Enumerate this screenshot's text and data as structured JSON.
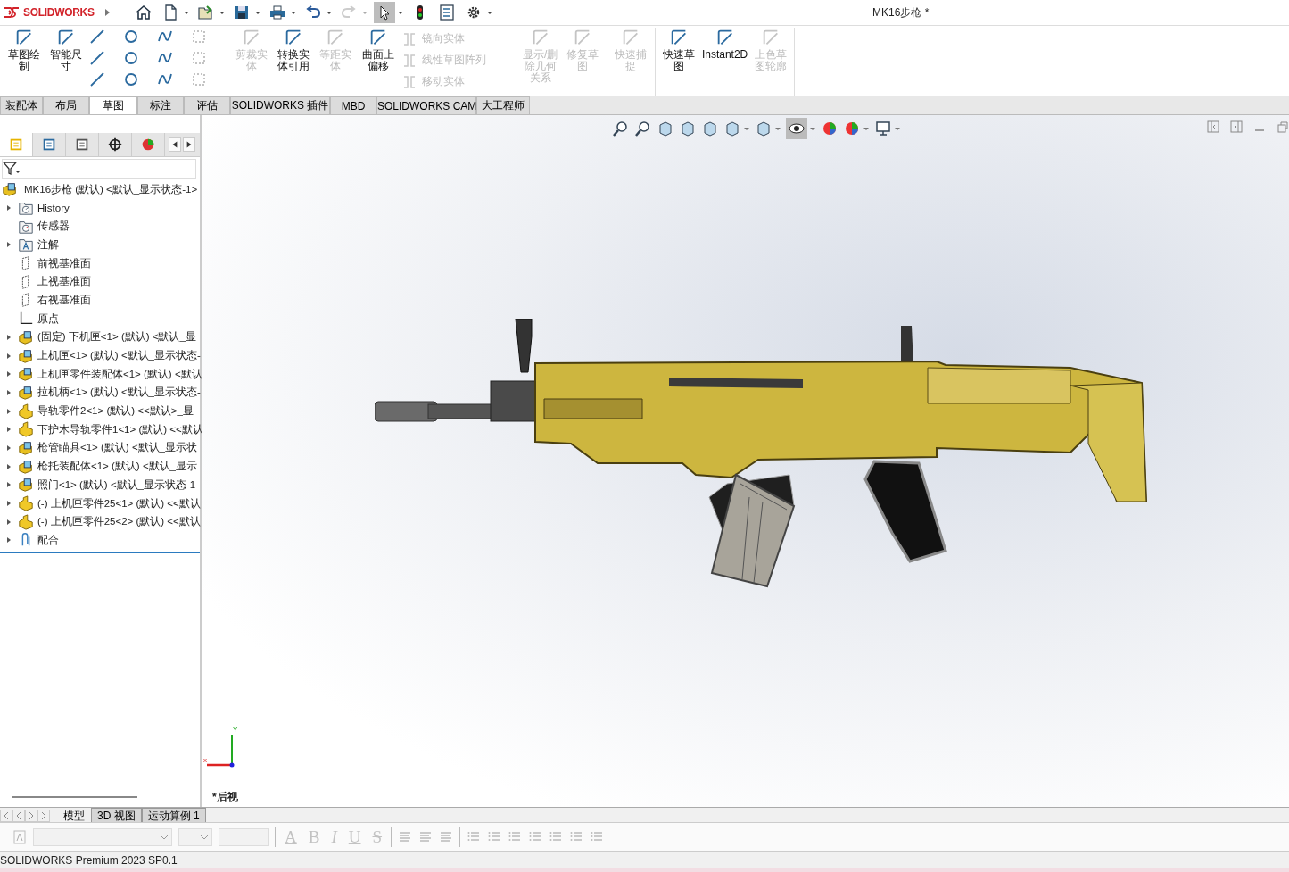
{
  "app": {
    "brand": "SOLIDWORKS",
    "title": "MK16步枪 *"
  },
  "command_groups": [
    {
      "buttons": [
        {
          "label": "草图绘制",
          "disabled": false
        },
        {
          "label": "智能尺寸",
          "disabled": false
        }
      ]
    },
    {
      "buttons": [
        {
          "label": "剪裁实体",
          "disabled": true
        },
        {
          "label": "转换实体引用",
          "disabled": false
        },
        {
          "label": "等距实体",
          "disabled": true
        },
        {
          "label": "曲面上偏移",
          "disabled": false
        }
      ],
      "list": [
        {
          "label": "镜向实体",
          "disabled": true
        },
        {
          "label": "线性草图阵列",
          "disabled": true
        },
        {
          "label": "移动实体",
          "disabled": true
        }
      ]
    },
    {
      "buttons": [
        {
          "label": "显示/删除几何关系",
          "disabled": true
        },
        {
          "label": "修复草图",
          "disabled": true
        }
      ]
    },
    {
      "buttons": [
        {
          "label": "快速捕捉",
          "disabled": true
        }
      ]
    },
    {
      "buttons": [
        {
          "label": "快速草图",
          "disabled": false
        },
        {
          "label": "Instant2D",
          "disabled": false
        },
        {
          "label": "上色草图轮廓",
          "disabled": true
        }
      ]
    }
  ],
  "tabs": [
    {
      "label": "装配体",
      "selected": false
    },
    {
      "label": "布局",
      "selected": false
    },
    {
      "label": "草图",
      "selected": true
    },
    {
      "label": "标注",
      "selected": false
    },
    {
      "label": "评估",
      "selected": false
    },
    {
      "label": "SOLIDWORKS 插件",
      "selected": false
    },
    {
      "label": "MBD",
      "selected": false
    },
    {
      "label": "SOLIDWORKS CAM",
      "selected": false
    },
    {
      "label": "大工程师",
      "selected": false
    }
  ],
  "panel_tabs": [
    {
      "selected": true
    },
    {
      "selected": false
    },
    {
      "selected": false
    },
    {
      "selected": false
    },
    {
      "selected": false
    }
  ],
  "tree": {
    "root": "MK16步枪 (默认) <默认_显示状态-1>",
    "items": [
      {
        "kind": "history",
        "label": "History",
        "expandable": true
      },
      {
        "kind": "sensor",
        "label": "传感器",
        "expandable": false
      },
      {
        "kind": "annotation",
        "label": "注解",
        "expandable": true
      },
      {
        "kind": "plane",
        "label": "前视基准面",
        "expandable": false
      },
      {
        "kind": "plane",
        "label": "上视基准面",
        "expandable": false
      },
      {
        "kind": "plane",
        "label": "右视基准面",
        "expandable": false
      },
      {
        "kind": "origin",
        "label": "原点",
        "expandable": false
      },
      {
        "kind": "assembly",
        "label": "(固定) 下机匣<1> (默认) <默认_显",
        "expandable": true
      },
      {
        "kind": "assembly",
        "label": "上机匣<1> (默认) <默认_显示状态-",
        "expandable": true
      },
      {
        "kind": "assembly",
        "label": "上机匣零件装配体<1> (默认) <默认",
        "expandable": true
      },
      {
        "kind": "assembly",
        "label": "拉机柄<1> (默认) <默认_显示状态-",
        "expandable": true
      },
      {
        "kind": "part",
        "label": "导轨零件2<1> (默认) <<默认>_显",
        "expandable": true
      },
      {
        "kind": "part",
        "label": "下护木导轨零件1<1> (默认) <<默认",
        "expandable": true
      },
      {
        "kind": "assembly",
        "label": "枪管瞄具<1> (默认) <默认_显示状",
        "expandable": true
      },
      {
        "kind": "assembly",
        "label": "枪托装配体<1> (默认) <默认_显示",
        "expandable": true
      },
      {
        "kind": "assembly",
        "label": "照门<1> (默认) <默认_显示状态-1",
        "expandable": true
      },
      {
        "kind": "part",
        "label": "(-) 上机匣零件25<1> (默认) <<默认",
        "expandable": true
      },
      {
        "kind": "part",
        "label": "(-) 上机匣零件25<2> (默认) <<默认",
        "expandable": true
      },
      {
        "kind": "mate",
        "label": "配合",
        "expandable": true
      }
    ]
  },
  "viewport": {
    "view_label": "*后视",
    "axis_y": "Y",
    "axis_x": "x"
  },
  "bottom_tabs": [
    {
      "label": "模型",
      "selected": true
    },
    {
      "label": "3D 视图",
      "selected": false
    },
    {
      "label": "运动算例 1",
      "selected": false
    }
  ],
  "format_toolbar": {
    "disabled": true,
    "styles": [
      "A",
      "B",
      "I",
      "U",
      "S"
    ]
  },
  "status_bar": "SOLIDWORKS Premium 2023 SP0.1"
}
